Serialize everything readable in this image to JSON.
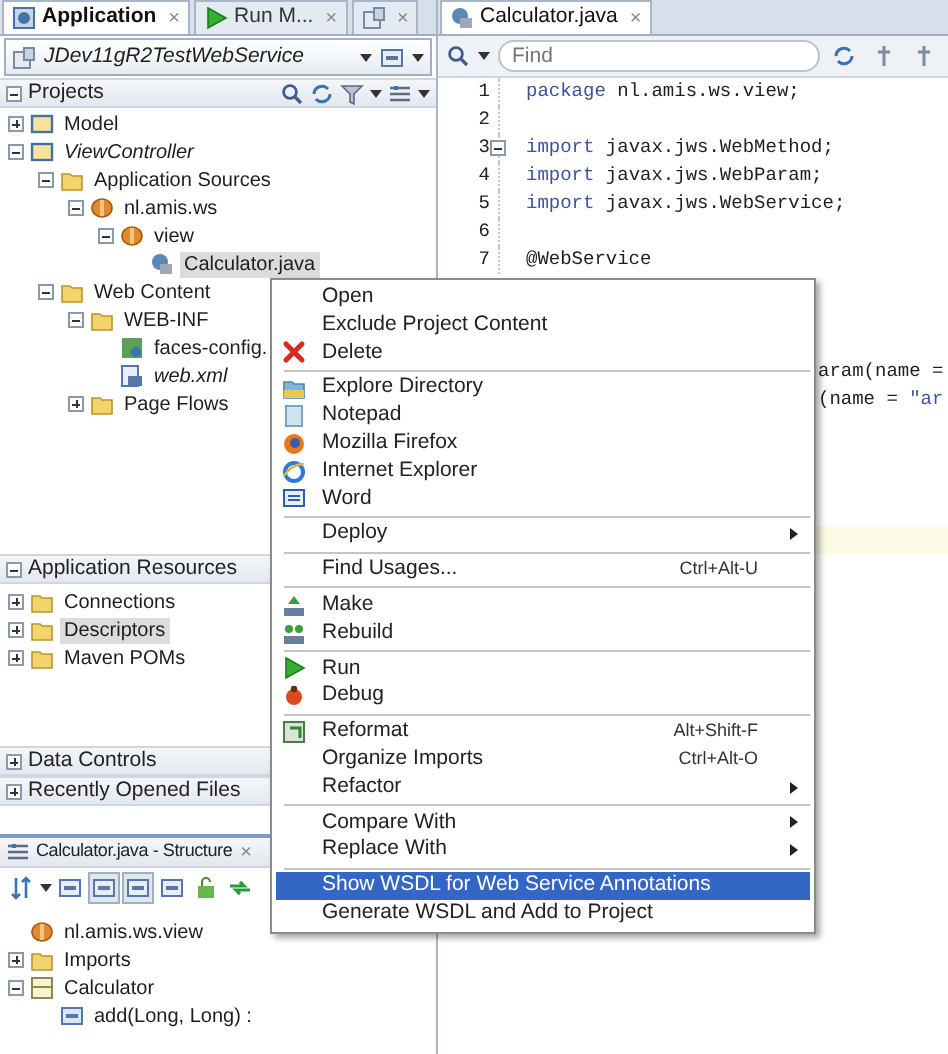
{
  "left_tabs": [
    {
      "kind": "text",
      "label": "Application",
      "close": "×",
      "selected": true
    },
    {
      "kind": "text",
      "label": "Run M...",
      "close": "×",
      "selected": false
    },
    {
      "kind": "icon",
      "close": "×",
      "selected": false
    }
  ],
  "project_selector": {
    "value": "JDev11gR2TestWebService"
  },
  "projects": {
    "title": "Projects",
    "expanded": true,
    "tree": [
      {
        "kind": "project",
        "label": "Model",
        "expanded": false,
        "italic": false,
        "selected": false
      },
      {
        "kind": "project",
        "label": "ViewController",
        "expanded": true,
        "italic": true,
        "selected": false,
        "children": [
          {
            "kind": "folder",
            "label": "Application Sources",
            "expanded": true,
            "italic": false,
            "selected": false,
            "children": [
              {
                "kind": "package",
                "label": "nl.amis.ws",
                "expanded": true,
                "italic": false,
                "selected": false,
                "children": [
                  {
                    "kind": "package",
                    "label": "view",
                    "expanded": true,
                    "italic": false,
                    "selected": false,
                    "children": [
                      {
                        "kind": "java",
                        "label": "Calculator.java",
                        "italic": false,
                        "selected": true
                      }
                    ]
                  }
                ]
              }
            ]
          },
          {
            "kind": "folder",
            "label": "Web Content",
            "expanded": true,
            "italic": false,
            "selected": false,
            "children": [
              {
                "kind": "folder",
                "label": "WEB-INF",
                "expanded": true,
                "italic": false,
                "selected": false,
                "children": [
                  {
                    "kind": "config",
                    "label": "faces-config.",
                    "italic": false,
                    "selected": false
                  },
                  {
                    "kind": "xml",
                    "label": "web.xml",
                    "italic": true,
                    "selected": false
                  }
                ]
              },
              {
                "kind": "folder",
                "label": "Page Flows",
                "expanded": false,
                "italic": false,
                "selected": false
              }
            ]
          }
        ]
      }
    ]
  },
  "resources": {
    "title": "Application Resources",
    "expanded": true,
    "tree": [
      {
        "kind": "folder",
        "label": "Connections",
        "expanded": false,
        "italic": false,
        "selected": false
      },
      {
        "kind": "folder",
        "label": "Descriptors",
        "expanded": false,
        "italic": false,
        "selected": true
      },
      {
        "kind": "folder",
        "label": "Maven POMs",
        "expanded": false,
        "italic": false,
        "selected": false
      }
    ]
  },
  "collapsed_sections": [
    {
      "title": "Data Controls",
      "expanded": false
    },
    {
      "title": "Recently Opened Files",
      "expanded": false
    }
  ],
  "structure": {
    "title": "Calculator.java - Structure",
    "close": "×",
    "toggles": [
      {
        "pressed": false
      },
      {
        "pressed": true
      },
      {
        "pressed": true
      },
      {
        "pressed": false
      }
    ],
    "tree": [
      {
        "kind": "package",
        "label": "nl.amis.ws.view",
        "italic": false,
        "selected": false
      },
      {
        "kind": "folder",
        "label": "Imports",
        "expanded": false,
        "italic": false,
        "selected": false
      },
      {
        "kind": "class",
        "label": "Calculator",
        "expanded": true,
        "italic": false,
        "selected": false,
        "children": [
          {
            "kind": "method",
            "label": "add(Long, Long) :",
            "italic": false,
            "selected": false
          }
        ]
      }
    ]
  },
  "editor": {
    "tab": {
      "label": "Calculator.java",
      "close": "×",
      "selected": true
    },
    "find": {
      "placeholder": "Find"
    },
    "lines": [
      {
        "kind": "full",
        "number": "1",
        "keyword": "package",
        "text": "nl.amis.ws.view;"
      },
      {
        "kind": "full",
        "number": "2"
      },
      {
        "kind": "full",
        "number": "3",
        "keyword": "import",
        "text": "javax.jws.WebMethod;",
        "fold": true
      },
      {
        "kind": "full",
        "number": "4",
        "keyword": "import",
        "text": "javax.jws.WebParam;"
      },
      {
        "kind": "full",
        "number": "5",
        "keyword": "import",
        "text": "javax.jws.WebService;"
      },
      {
        "kind": "full",
        "number": "6"
      },
      {
        "kind": "full",
        "number": "7",
        "text": "@WebService"
      },
      {
        "kind": "hidden"
      },
      {
        "kind": "hidden"
      },
      {
        "kind": "hidden"
      },
      {
        "kind": "tail",
        "text": "aram(name ="
      },
      {
        "kind": "tail",
        "text": "(name = ",
        "string": "\"ar"
      },
      {
        "kind": "hidden"
      },
      {
        "kind": "hidden"
      },
      {
        "kind": "hidden"
      },
      {
        "kind": "hidden"
      },
      {
        "kind": "hidden",
        "highlighted": true
      }
    ]
  },
  "context_menu": [
    {
      "kind": "item",
      "label": "Open",
      "selected": false
    },
    {
      "kind": "item",
      "label": "Exclude Project Content",
      "selected": false
    },
    {
      "kind": "item",
      "label": "Delete",
      "selected": false
    },
    {
      "kind": "separator"
    },
    {
      "kind": "item",
      "label": "Explore Directory",
      "selected": false
    },
    {
      "kind": "item",
      "label": "Notepad",
      "selected": false
    },
    {
      "kind": "item",
      "label": "Mozilla Firefox",
      "selected": false
    },
    {
      "kind": "item",
      "label": "Internet Explorer",
      "selected": false
    },
    {
      "kind": "item",
      "label": "Word",
      "selected": false
    },
    {
      "kind": "separator"
    },
    {
      "kind": "item",
      "label": "Deploy",
      "submenu": true,
      "selected": false
    },
    {
      "kind": "separator"
    },
    {
      "kind": "item",
      "label": "Find Usages...",
      "shortcut": "Ctrl+Alt-U",
      "selected": false
    },
    {
      "kind": "separator"
    },
    {
      "kind": "item",
      "label": "Make",
      "selected": false
    },
    {
      "kind": "item",
      "label": "Rebuild",
      "selected": false
    },
    {
      "kind": "separator"
    },
    {
      "kind": "item",
      "label": "Run",
      "selected": false
    },
    {
      "kind": "item",
      "label": "Debug",
      "selected": false
    },
    {
      "kind": "separator"
    },
    {
      "kind": "item",
      "label": "Reformat",
      "shortcut": "Alt+Shift-F",
      "selected": false
    },
    {
      "kind": "item",
      "label": "Organize Imports",
      "shortcut": "Ctrl+Alt-O",
      "selected": false
    },
    {
      "kind": "item",
      "label": "Refactor",
      "submenu": true,
      "selected": false
    },
    {
      "kind": "separator"
    },
    {
      "kind": "item",
      "label": "Compare With",
      "submenu": true,
      "selected": false
    },
    {
      "kind": "item",
      "label": "Replace With",
      "submenu": true,
      "selected": false
    },
    {
      "kind": "separator"
    },
    {
      "kind": "item",
      "label": "Show WSDL for Web Service Annotations",
      "selected": true
    },
    {
      "kind": "item",
      "label": "Generate WSDL and Add to Project",
      "selected": false
    }
  ]
}
